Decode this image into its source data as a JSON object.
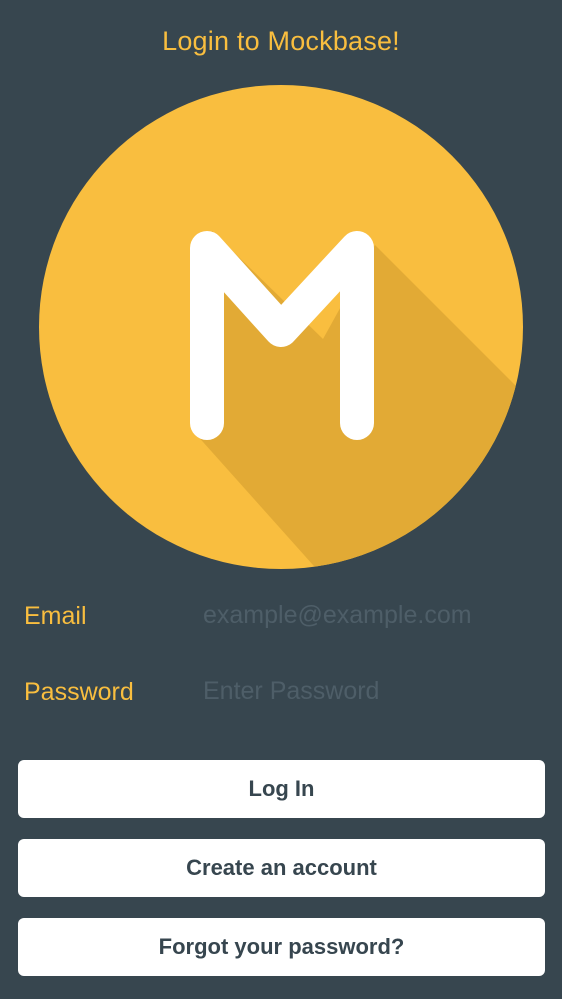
{
  "header": {
    "title": "Login to Mockbase!"
  },
  "logo": {
    "letter": "M",
    "icon": "mockbase-logo-icon",
    "circle_color": "#f9be3f",
    "shadow_color": "#e0a935"
  },
  "form": {
    "email": {
      "label": "Email",
      "value": "",
      "placeholder": "example@example.com"
    },
    "password": {
      "label": "Password",
      "value": "",
      "placeholder": "Enter Password"
    }
  },
  "buttons": {
    "login_label": "Log In",
    "create_account_label": "Create an account",
    "forgot_password_label": "Forgot your password?"
  },
  "colors": {
    "background": "#37464f",
    "accent": "#f9be3f",
    "button_bg": "#ffffff",
    "button_text": "#37464f",
    "placeholder": "#4e5e68"
  }
}
